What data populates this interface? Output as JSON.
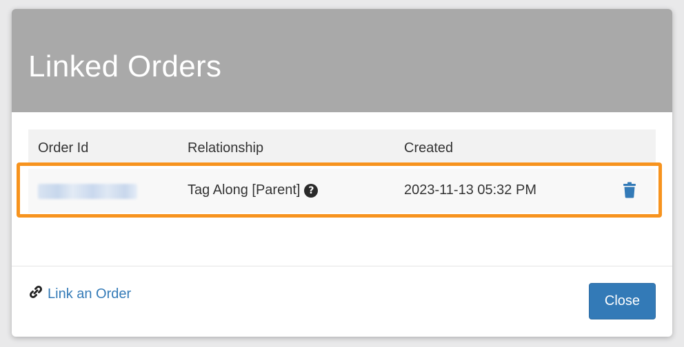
{
  "modal": {
    "title": "Linked Orders"
  },
  "table": {
    "headers": {
      "order_id": "Order Id",
      "relationship": "Relationship",
      "created": "Created"
    },
    "rows": [
      {
        "relationship": "Tag Along [Parent]",
        "created": "2023-11-13 05:32 PM"
      }
    ]
  },
  "footer": {
    "link_label": "Link an Order",
    "close_label": "Close"
  },
  "colors": {
    "header_bg": "#a9a9a9",
    "accent": "#337ab7",
    "highlight": "#f7931e"
  },
  "icons": [
    "help-icon",
    "trash-icon",
    "link-icon"
  ]
}
